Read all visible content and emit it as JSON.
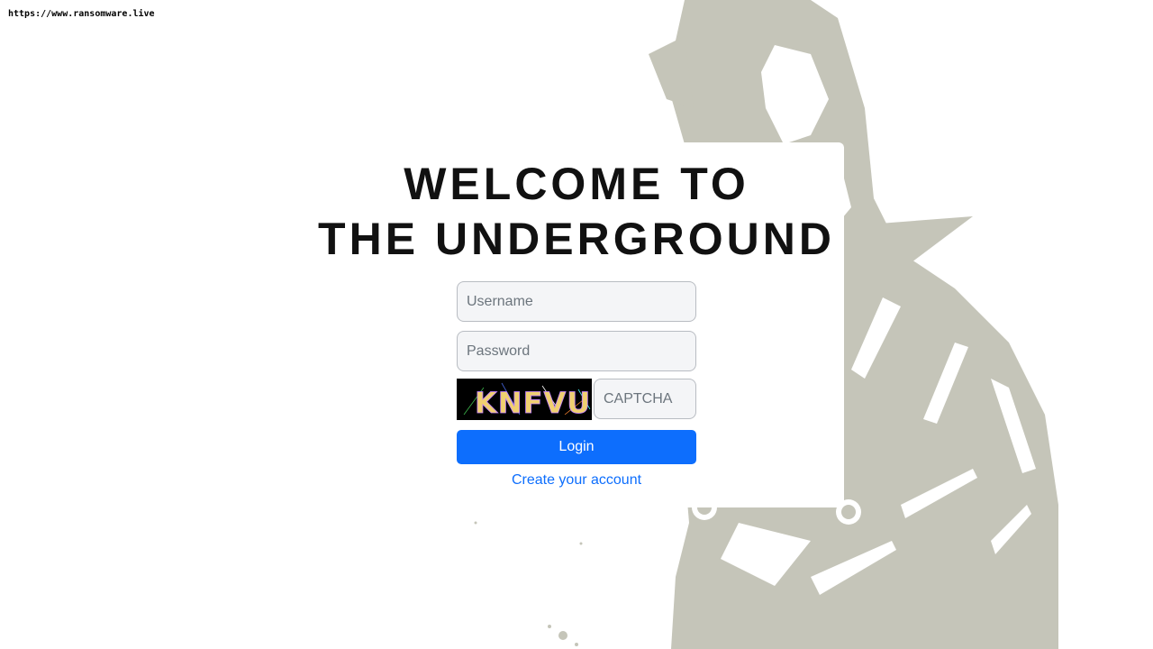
{
  "source_url": "https://www.ransomware.live",
  "title": {
    "line1": "WELCOME TO",
    "line2": "THE UNDERGROUND"
  },
  "form": {
    "username_placeholder": "Username",
    "password_placeholder": "Password",
    "captcha_placeholder": "CAPTCHA",
    "captcha_code": "KNFVU",
    "login_label": "Login",
    "create_account_label": "Create your account"
  },
  "colors": {
    "accent": "#0d6efd",
    "background_art": "#c5c5b9"
  }
}
